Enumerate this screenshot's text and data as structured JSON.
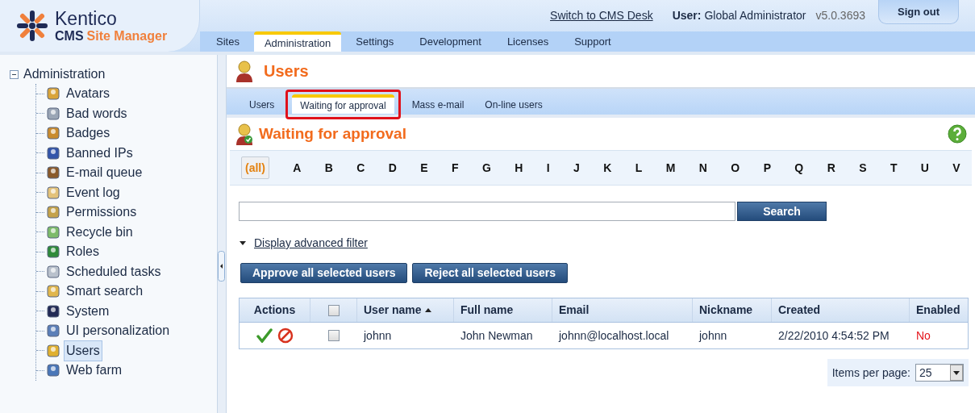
{
  "header": {
    "logo": {
      "brand": "Kentico",
      "product_prefix": "CMS",
      "product_name": "Site Manager"
    },
    "switch_link": "Switch to CMS Desk",
    "user_label": "User:",
    "user_name": "Global Administrator",
    "version": "v5.0.3693",
    "sign_out": "Sign out"
  },
  "main_tabs": [
    {
      "label": "Sites",
      "selected": false
    },
    {
      "label": "Administration",
      "selected": true
    },
    {
      "label": "Settings",
      "selected": false
    },
    {
      "label": "Development",
      "selected": false
    },
    {
      "label": "Licenses",
      "selected": false
    },
    {
      "label": "Support",
      "selected": false
    }
  ],
  "sidebar": {
    "tree": {
      "label": "Administration",
      "expanded": true,
      "children": [
        {
          "label": "Avatars",
          "selected": false
        },
        {
          "label": "Bad words",
          "selected": false
        },
        {
          "label": "Badges",
          "selected": false
        },
        {
          "label": "Banned IPs",
          "selected": false
        },
        {
          "label": "E-mail queue",
          "selected": false
        },
        {
          "label": "Event log",
          "selected": false
        },
        {
          "label": "Permissions",
          "selected": false
        },
        {
          "label": "Recycle bin",
          "selected": false
        },
        {
          "label": "Roles",
          "selected": false
        },
        {
          "label": "Scheduled tasks",
          "selected": false
        },
        {
          "label": "Smart search",
          "selected": false
        },
        {
          "label": "System",
          "selected": false
        },
        {
          "label": "UI personalization",
          "selected": false
        },
        {
          "label": "Users",
          "selected": true
        },
        {
          "label": "Web farm",
          "selected": false
        }
      ]
    }
  },
  "page_title": "Users",
  "sub_tabs": [
    {
      "label": "Users",
      "selected": false,
      "highlighted": false
    },
    {
      "label": "Waiting for approval",
      "selected": true,
      "highlighted": true
    },
    {
      "label": "Mass e-mail",
      "selected": false,
      "highlighted": false
    },
    {
      "label": "On-line users",
      "selected": false,
      "highlighted": false
    }
  ],
  "section_title": "Waiting for approval",
  "letters": [
    {
      "label": "(all)",
      "selected": true
    },
    {
      "label": "A",
      "selected": false
    },
    {
      "label": "B",
      "selected": false
    },
    {
      "label": "C",
      "selected": false
    },
    {
      "label": "D",
      "selected": false
    },
    {
      "label": "E",
      "selected": false
    },
    {
      "label": "F",
      "selected": false
    },
    {
      "label": "G",
      "selected": false
    },
    {
      "label": "H",
      "selected": false
    },
    {
      "label": "I",
      "selected": false
    },
    {
      "label": "J",
      "selected": false
    },
    {
      "label": "K",
      "selected": false
    },
    {
      "label": "L",
      "selected": false
    },
    {
      "label": "M",
      "selected": false
    },
    {
      "label": "N",
      "selected": false
    },
    {
      "label": "O",
      "selected": false
    },
    {
      "label": "P",
      "selected": false
    },
    {
      "label": "Q",
      "selected": false
    },
    {
      "label": "R",
      "selected": false
    },
    {
      "label": "S",
      "selected": false
    },
    {
      "label": "T",
      "selected": false
    },
    {
      "label": "U",
      "selected": false
    },
    {
      "label": "V",
      "selected": false
    }
  ],
  "search_button": "Search",
  "advanced_filter": "Display advanced filter",
  "bulk_buttons": [
    "Approve all selected users",
    "Reject all selected users"
  ],
  "table": {
    "select_all_checked": false,
    "columns": [
      {
        "label": "Actions",
        "kind": "text"
      },
      {
        "kind": "checkbox"
      },
      {
        "label": "User name",
        "kind": "text",
        "sorted": true
      },
      {
        "label": "Full name",
        "kind": "text"
      },
      {
        "label": "Email",
        "kind": "text"
      },
      {
        "label": "Nickname",
        "kind": "text"
      },
      {
        "label": "Created",
        "kind": "text"
      },
      {
        "label": "Enabled",
        "kind": "text"
      }
    ],
    "rows": [
      {
        "checked": false,
        "user_name": "johnn",
        "full_name": "John Newman",
        "email": "johnn@localhost.local",
        "nickname": "johnn",
        "created": "2/22/2010 4:54:52 PM",
        "enabled": "No",
        "enabled_state": false
      }
    ]
  },
  "pager": {
    "label": "Items per page:",
    "value": "25"
  }
}
